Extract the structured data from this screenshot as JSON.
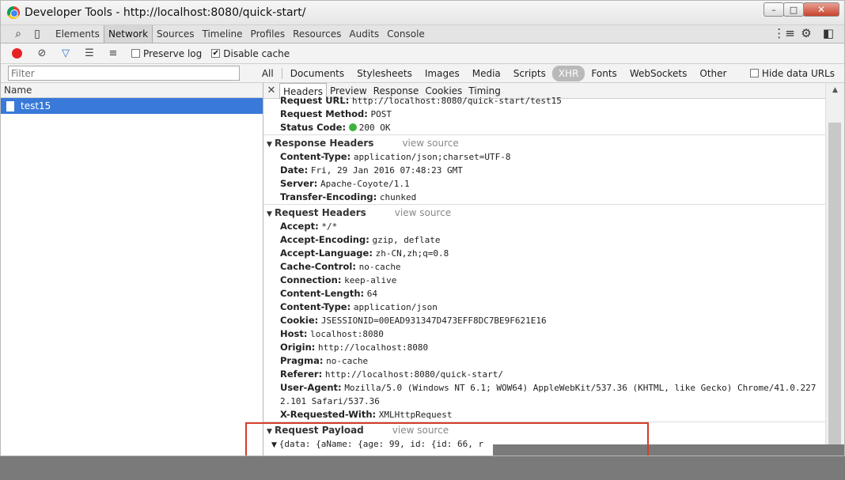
{
  "window": {
    "title": "Developer Tools - http://localhost:8080/quick-start/",
    "minimize": "–",
    "maximize": "□",
    "close": "✕"
  },
  "panels": [
    "Elements",
    "Network",
    "Sources",
    "Timeline",
    "Profiles",
    "Resources",
    "Audits",
    "Console"
  ],
  "toolbar": {
    "preserve_log": "Preserve log",
    "disable_cache": "Disable cache",
    "disable_cache_checked": "✔"
  },
  "filter": {
    "placeholder": "Filter",
    "types": [
      "All",
      "Documents",
      "Stylesheets",
      "Images",
      "Media",
      "Scripts",
      "XHR",
      "Fonts",
      "WebSockets",
      "Other"
    ],
    "active_type": "XHR",
    "hide_data_urls": "Hide data URLs"
  },
  "requests": {
    "column_header": "Name",
    "items": [
      "test15"
    ]
  },
  "detail_tabs": [
    "Headers",
    "Preview",
    "Response",
    "Cookies",
    "Timing"
  ],
  "general": [
    {
      "k": "Request URL:",
      "v": "http://localhost:8080/quick-start/test15"
    },
    {
      "k": "Request Method:",
      "v": "POST"
    },
    {
      "k": "Status Code:",
      "v": "200 OK"
    }
  ],
  "response_headers": {
    "title": "Response Headers",
    "view_source": "view source",
    "items": [
      {
        "k": "Content-Type:",
        "v": "application/json;charset=UTF-8"
      },
      {
        "k": "Date:",
        "v": "Fri, 29 Jan 2016 07:48:23 GMT"
      },
      {
        "k": "Server:",
        "v": "Apache-Coyote/1.1"
      },
      {
        "k": "Transfer-Encoding:",
        "v": "chunked"
      }
    ]
  },
  "request_headers": {
    "title": "Request Headers",
    "view_source": "view source",
    "items": [
      {
        "k": "Accept:",
        "v": "*/*"
      },
      {
        "k": "Accept-Encoding:",
        "v": "gzip, deflate"
      },
      {
        "k": "Accept-Language:",
        "v": "zh-CN,zh;q=0.8"
      },
      {
        "k": "Cache-Control:",
        "v": "no-cache"
      },
      {
        "k": "Connection:",
        "v": "keep-alive"
      },
      {
        "k": "Content-Length:",
        "v": "64"
      },
      {
        "k": "Content-Type:",
        "v": "application/json"
      },
      {
        "k": "Cookie:",
        "v": "JSESSIONID=00EAD931347D473EFF8DC7BE9F621E16"
      },
      {
        "k": "Host:",
        "v": "localhost:8080"
      },
      {
        "k": "Origin:",
        "v": "http://localhost:8080"
      },
      {
        "k": "Pragma:",
        "v": "no-cache"
      },
      {
        "k": "Referer:",
        "v": "http://localhost:8080/quick-start/"
      },
      {
        "k": "User-Agent:",
        "v": "Mozilla/5.0 (Windows NT 6.1; WOW64) AppleWebKit/537.36 (KHTML, like Gecko) Chrome/41.0.227"
      },
      {
        "k": "",
        "v": "2.101 Safari/537.36"
      },
      {
        "k": "X-Requested-With:",
        "v": "XMLHttpRequest"
      }
    ]
  },
  "request_payload": {
    "title": "Request Payload",
    "view_source": "view source",
    "preview": "{data: {aName: {age: 99, id: {id: 66, r"
  }
}
